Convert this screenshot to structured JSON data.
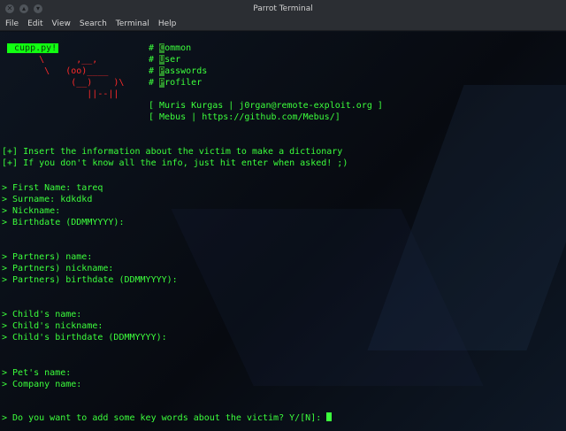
{
  "window": {
    "title": "Parrot Terminal",
    "controls": [
      "close-icon",
      "maximize-icon",
      "minimize-icon"
    ]
  },
  "menu": [
    "File",
    "Edit",
    "View",
    "Search",
    "Terminal",
    "Help"
  ],
  "banner": {
    "badge": " cupp.py!",
    "ascii": [
      "     \\      ,__,",
      "      \\   (oo)____",
      "           (__)    )\\",
      "              ||--||"
    ],
    "comments": [
      {
        "hash": "# ",
        "first": "C",
        "rest": "ommon"
      },
      {
        "hash": "# ",
        "first": "U",
        "rest": "ser"
      },
      {
        "hash": "# ",
        "first": "P",
        "rest": "asswords"
      },
      {
        "hash": "# ",
        "first": "P",
        "rest": "rofiler"
      }
    ],
    "credits": [
      "[ Muris Kurgas | j0rgan@remote-exploit.org ]",
      "[ Mebus | https://github.com/Mebus/]"
    ]
  },
  "info": [
    "[+] Insert the information about the victim to make a dictionary",
    "[+] If you don't know all the info, just hit enter when asked! ;)"
  ],
  "victim": [
    "> First Name: tareq",
    "> Surname: kdkdkd",
    "> Nickname:",
    "> Birthdate (DDMMYYYY):"
  ],
  "partner": [
    "> Partners) name:",
    "> Partners) nickname:",
    "> Partners) birthdate (DDMMYYYY):"
  ],
  "child": [
    "> Child's name:",
    "> Child's nickname:",
    "> Child's birthdate (DDMMYYYY):"
  ],
  "other": [
    "> Pet's name:",
    "> Company name:"
  ],
  "prompt": "> Do you want to add some key words about the victim? Y/[N]: ",
  "colors": {
    "text": "#3cff3c",
    "ascii": "#ff2a2a",
    "background": "#0b1018"
  }
}
